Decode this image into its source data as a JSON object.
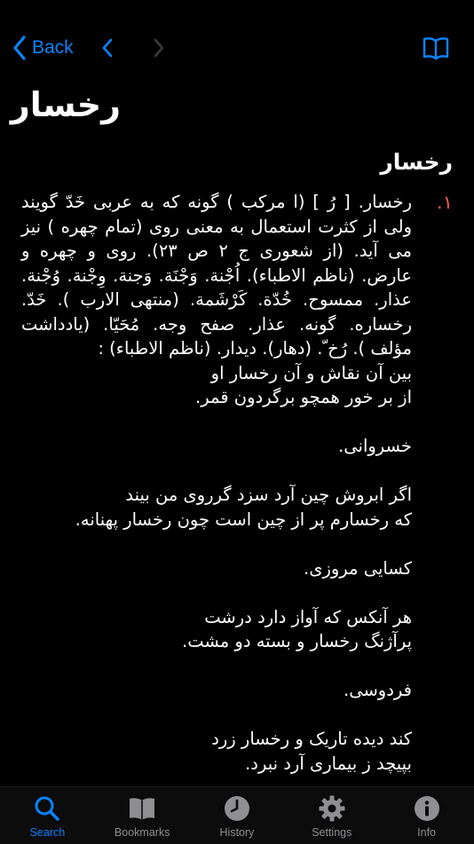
{
  "nav": {
    "back_label": "Back"
  },
  "page_title": "رخسار",
  "entry": {
    "headword": "رخسار",
    "number": "۱.",
    "definition": "رخسار. [ رُ ] (ا مرکب ) گونه که به عربی خَدّ گویند ولی از کثرت استعمال به معنی روی (تمام چهره ) نیز می آید. (از شعوری ج ۲ ص ۲۳). روی و چهره و عارض. (ناظم الاطباء). اُجْنة. وَجْنَة. وَجنة. وِجْنة. وُجْنة. عذار. ممسوح. خُدّة. کَرْشَمة. (منتهی الارب ). خَدّ. رخساره. گونه. عذار. صفح وجه. مُحَیّا. (یادداشت مؤلف ). رُخ ّ. (دهار). دیدار. (ناظم الاطباء) :\nبین آن نقاش و آن رخسار او\nاز بر خور همچو برگردون قمر.\n\nخسروانی.\n\nاگر ابروش چین آرد سزد گرروی من بیند\nکه رخسارم پر از چین است چون رخسار پهنانه.\n\nکسایی مروزی.\n\nهر آنکس که آواز دارد درشت\nپرآژنگ رخسار و بسته دو مشت.\n\nفردوسی.\n\nکند دیده تاریک و رخسار زرد\nبپیچد ز بیماری آرد نبرد."
  },
  "tabs": [
    {
      "label": "Search",
      "icon": "search-icon",
      "active": true
    },
    {
      "label": "Bookmarks",
      "icon": "bookmarks-icon",
      "active": false
    },
    {
      "label": "History",
      "icon": "history-icon",
      "active": false
    },
    {
      "label": "Settings",
      "icon": "settings-icon",
      "active": false
    },
    {
      "label": "Info",
      "icon": "info-icon",
      "active": false
    }
  ],
  "colors": {
    "accent": "#0a84ff",
    "number": "#ff5a4f",
    "inactive": "#8e8e93"
  }
}
